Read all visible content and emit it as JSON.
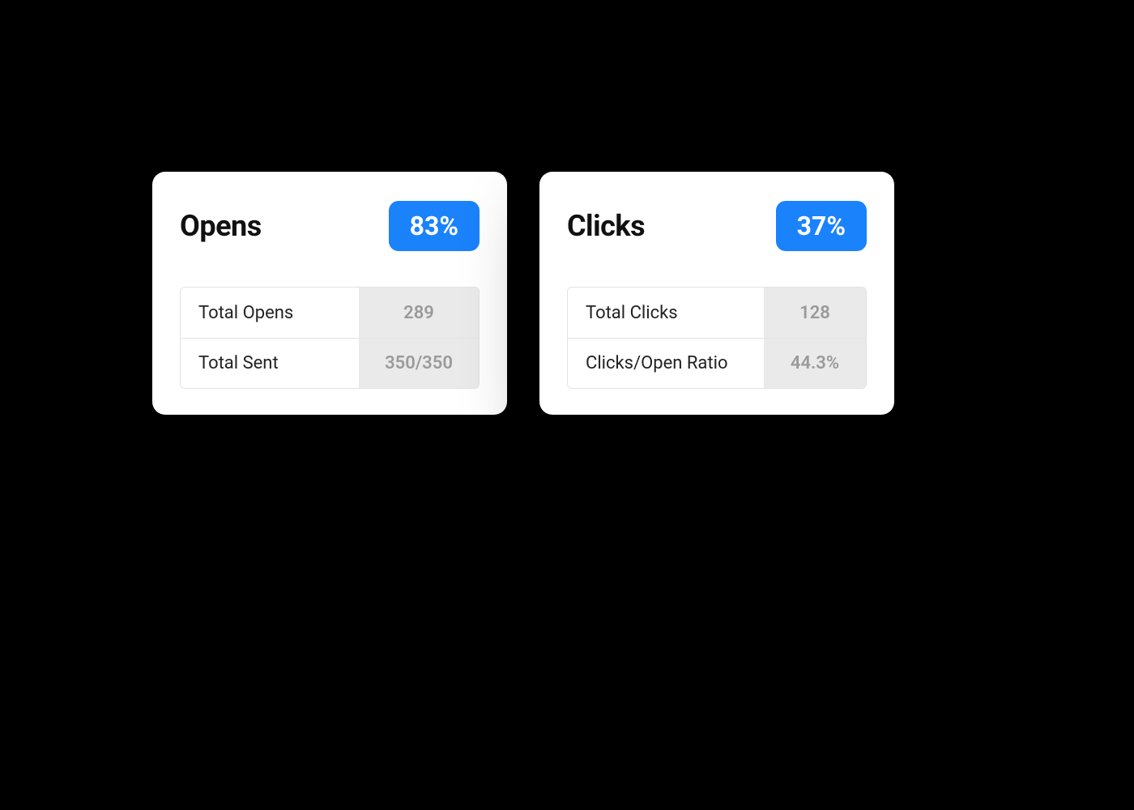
{
  "cards": [
    {
      "title": "Opens",
      "badge": "83%",
      "rows": [
        {
          "label": "Total Opens",
          "value": "289"
        },
        {
          "label": "Total Sent",
          "value": "350/350"
        }
      ]
    },
    {
      "title": "Clicks",
      "badge": "37%",
      "rows": [
        {
          "label": "Total Clicks",
          "value": "128"
        },
        {
          "label": "Clicks/Open Ratio",
          "value": "44.3%"
        }
      ]
    }
  ]
}
